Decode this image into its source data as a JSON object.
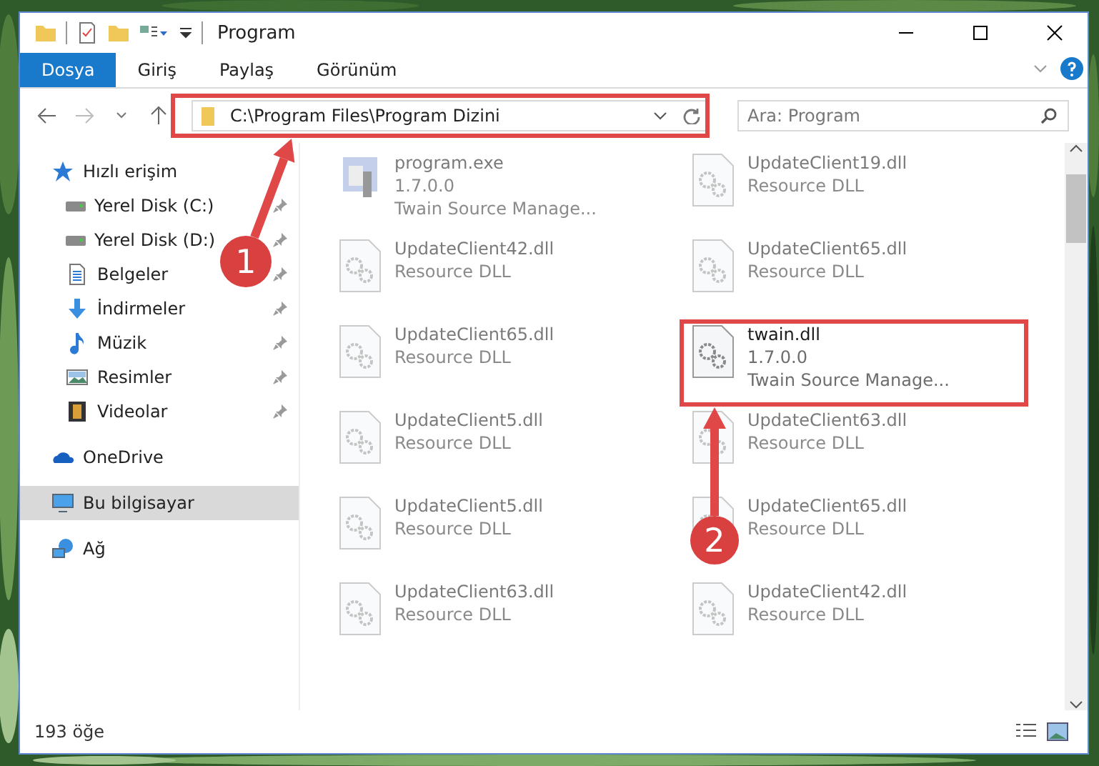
{
  "window": {
    "title": "Program"
  },
  "ribbon_tabs": [
    {
      "label": "Dosya",
      "selected": true
    },
    {
      "label": "Giriş",
      "selected": false
    },
    {
      "label": "Paylaş",
      "selected": false
    },
    {
      "label": "Görünüm",
      "selected": false
    }
  ],
  "address_bar": {
    "path": "C:\\Program Files\\Program Dizini"
  },
  "search": {
    "placeholder": "Ara: Program"
  },
  "sidebar": {
    "items": [
      {
        "label": "Hızlı erişim",
        "kind": "star",
        "selected": false,
        "children": [
          {
            "label": "Yerel Disk (C:)",
            "kind": "drive",
            "pinned": true,
            "selected": false
          },
          {
            "label": "Yerel Disk (D:)",
            "kind": "drive",
            "pinned": true,
            "selected": false
          },
          {
            "label": "Belgeler",
            "kind": "document",
            "pinned": true,
            "selected": false
          },
          {
            "label": "İndirmeler",
            "kind": "download",
            "pinned": true,
            "selected": false
          },
          {
            "label": "Müzik",
            "kind": "music",
            "pinned": true,
            "selected": false
          },
          {
            "label": "Resimler",
            "kind": "pictures",
            "pinned": true,
            "selected": false
          },
          {
            "label": "Videolar",
            "kind": "video",
            "pinned": true,
            "selected": false
          }
        ]
      },
      {
        "label": "OneDrive",
        "kind": "cloud",
        "selected": false
      },
      {
        "label": "Bu bilgisayar",
        "kind": "computer",
        "selected": true
      },
      {
        "label": "Ağ",
        "kind": "network",
        "selected": false
      }
    ]
  },
  "files": [
    {
      "name": "program.exe",
      "kind": "exe",
      "details": [
        "1.7.0.0",
        "Twain Source Manage..."
      ],
      "dimmed": true
    },
    {
      "name": "UpdateClient19.dll",
      "kind": "dll",
      "details": [
        "Resource DLL"
      ],
      "dimmed": true
    },
    {
      "name": "UpdateClient42.dll",
      "kind": "dll",
      "details": [
        "Resource DLL"
      ],
      "dimmed": true
    },
    {
      "name": "UpdateClient65.dll",
      "kind": "dll",
      "details": [
        "Resource DLL"
      ],
      "dimmed": true
    },
    {
      "name": "UpdateClient65.dll",
      "kind": "dll",
      "details": [
        "Resource DLL"
      ],
      "dimmed": true
    },
    {
      "name": "twain.dll",
      "kind": "dll",
      "details": [
        "1.7.0.0",
        "Twain Source Manage..."
      ],
      "dimmed": false
    },
    {
      "name": "UpdateClient5.dll",
      "kind": "dll",
      "details": [
        "Resource DLL"
      ],
      "dimmed": true
    },
    {
      "name": "UpdateClient63.dll",
      "kind": "dll",
      "details": [
        "Resource DLL"
      ],
      "dimmed": true
    },
    {
      "name": "UpdateClient5.dll",
      "kind": "dll",
      "details": [
        "Resource DLL"
      ],
      "dimmed": true
    },
    {
      "name": "UpdateClient65.dll",
      "kind": "dll",
      "details": [
        "Resource DLL"
      ],
      "dimmed": true
    },
    {
      "name": "UpdateClient63.dll",
      "kind": "dll",
      "details": [
        "Resource DLL"
      ],
      "dimmed": true
    },
    {
      "name": "UpdateClient42.dll",
      "kind": "dll",
      "details": [
        "Resource DLL"
      ],
      "dimmed": true
    }
  ],
  "status_bar": {
    "item_count": "193 öğe"
  },
  "annotations": [
    {
      "number": "1"
    },
    {
      "number": "2"
    }
  ]
}
